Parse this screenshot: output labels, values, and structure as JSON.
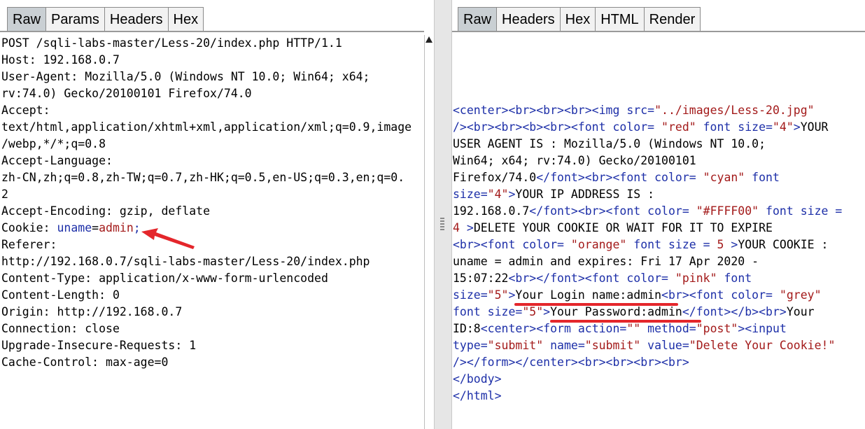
{
  "request_panel": {
    "tabs": [
      "Raw",
      "Params",
      "Headers",
      "Hex"
    ],
    "active_tab": "Raw",
    "lines": [
      "POST /sqli-labs-master/Less-20/index.php HTTP/1.1",
      "Host: 192.168.0.7",
      "User-Agent: Mozilla/5.0 (Windows NT 10.0; Win64; x64;",
      "rv:74.0) Gecko/20100101 Firefox/74.0",
      "Accept:",
      "text/html,application/xhtml+xml,application/xml;q=0.9,image",
      "/webp,*/*;q=0.8",
      "Accept-Language:",
      "zh-CN,zh;q=0.8,zh-TW;q=0.7,zh-HK;q=0.5,en-US;q=0.3,en;q=0.",
      "2",
      "Accept-Encoding: gzip, deflate",
      "Cookie: uname=admin;",
      "Referer:",
      "http://192.168.0.7/sqli-labs-master/Less-20/index.php",
      "Content-Type: application/x-www-form-urlencoded",
      "Content-Length: 0",
      "Origin: http://192.168.0.7",
      "Connection: close",
      "Upgrade-Insecure-Requests: 1",
      "Cache-Control: max-age=0"
    ],
    "cookie": {
      "prefix": "Cookie: ",
      "name": "uname",
      "eq": "=",
      "value": "admin",
      "suffix": ";"
    }
  },
  "response_panel": {
    "tabs": [
      "Raw",
      "Headers",
      "Hex",
      "HTML",
      "Render"
    ],
    "active_tab": "Raw",
    "lines": [
      [
        [
          "t",
          "<center><br><br><br><img src="
        ],
        [
          "s",
          "\"../images/Less-20.jpg\""
        ]
      ],
      [
        [
          "t",
          "/><br><br><b><br><font color= "
        ],
        [
          "s",
          "\"red\""
        ],
        [
          "t",
          " font size="
        ],
        [
          "s",
          "\"4\""
        ],
        [
          "t",
          ">"
        ],
        [
          "p",
          "YOUR"
        ]
      ],
      [
        [
          "p",
          "USER AGENT IS : Mozilla/5.0 (Windows NT 10.0;"
        ]
      ],
      [
        [
          "p",
          "Win64; x64; rv:74.0) Gecko/20100101"
        ]
      ],
      [
        [
          "p",
          "Firefox/74.0"
        ],
        [
          "t",
          "</font><br><font color= "
        ],
        [
          "s",
          "\"cyan\""
        ],
        [
          "t",
          " font"
        ]
      ],
      [
        [
          "t",
          "size="
        ],
        [
          "s",
          "\"4\""
        ],
        [
          "t",
          ">"
        ],
        [
          "p",
          "YOUR IP ADDRESS IS :"
        ]
      ],
      [
        [
          "p",
          "192.168.0.7"
        ],
        [
          "t",
          "</font><br><font color= "
        ],
        [
          "s",
          "\"#FFFF00\""
        ],
        [
          "t",
          " font size ="
        ]
      ],
      [
        [
          "s",
          "4"
        ],
        [
          "t",
          " >"
        ],
        [
          "p",
          "DELETE YOUR COOKIE OR WAIT FOR IT TO EXPIRE"
        ]
      ],
      [
        [
          "t",
          "<br><font color= "
        ],
        [
          "s",
          "\"orange\""
        ],
        [
          "t",
          " font size = "
        ],
        [
          "s",
          "5"
        ],
        [
          "t",
          " >"
        ],
        [
          "p",
          "YOUR COOKIE :"
        ]
      ],
      [
        [
          "p",
          "uname = admin and expires: Fri 17 Apr 2020 -"
        ]
      ],
      [
        [
          "p",
          "15:07:22"
        ],
        [
          "t",
          "<br></font><font color= "
        ],
        [
          "s",
          "\"pink\""
        ],
        [
          "t",
          " font"
        ]
      ],
      [
        [
          "t",
          "size="
        ],
        [
          "s",
          "\"5\""
        ],
        [
          "t",
          ">"
        ],
        [
          "p",
          "Your Login name:admin"
        ],
        [
          "t",
          "<br><font color= "
        ],
        [
          "s",
          "\"grey\""
        ]
      ],
      [
        [
          "t",
          "font size="
        ],
        [
          "s",
          "\"5\""
        ],
        [
          "t",
          ">"
        ],
        [
          "p",
          "Your Password:admin"
        ],
        [
          "t",
          "</font></b><br>"
        ],
        [
          "p",
          "Your"
        ]
      ],
      [
        [
          "p",
          "ID:8"
        ],
        [
          "t",
          "<center><form action="
        ],
        [
          "s",
          "\"\""
        ],
        [
          "t",
          " method="
        ],
        [
          "s",
          "\"post\""
        ],
        [
          "t",
          "><input"
        ]
      ],
      [
        [
          "t",
          "type="
        ],
        [
          "s",
          "\"submit\""
        ],
        [
          "t",
          " name="
        ],
        [
          "s",
          "\"submit\""
        ],
        [
          "t",
          " value="
        ],
        [
          "s",
          "\"Delete Your Cookie!\""
        ]
      ],
      [
        [
          "t",
          "/></form></center><br><br><br><br>"
        ]
      ],
      [
        [
          "t",
          "</body>"
        ]
      ],
      [
        [
          "t",
          "</html>"
        ]
      ]
    ]
  },
  "colors": {
    "tag": "#1d2fa8",
    "string": "#a31a1a",
    "annotation": "#e4262b",
    "active_tab": "#c9cfd3"
  }
}
